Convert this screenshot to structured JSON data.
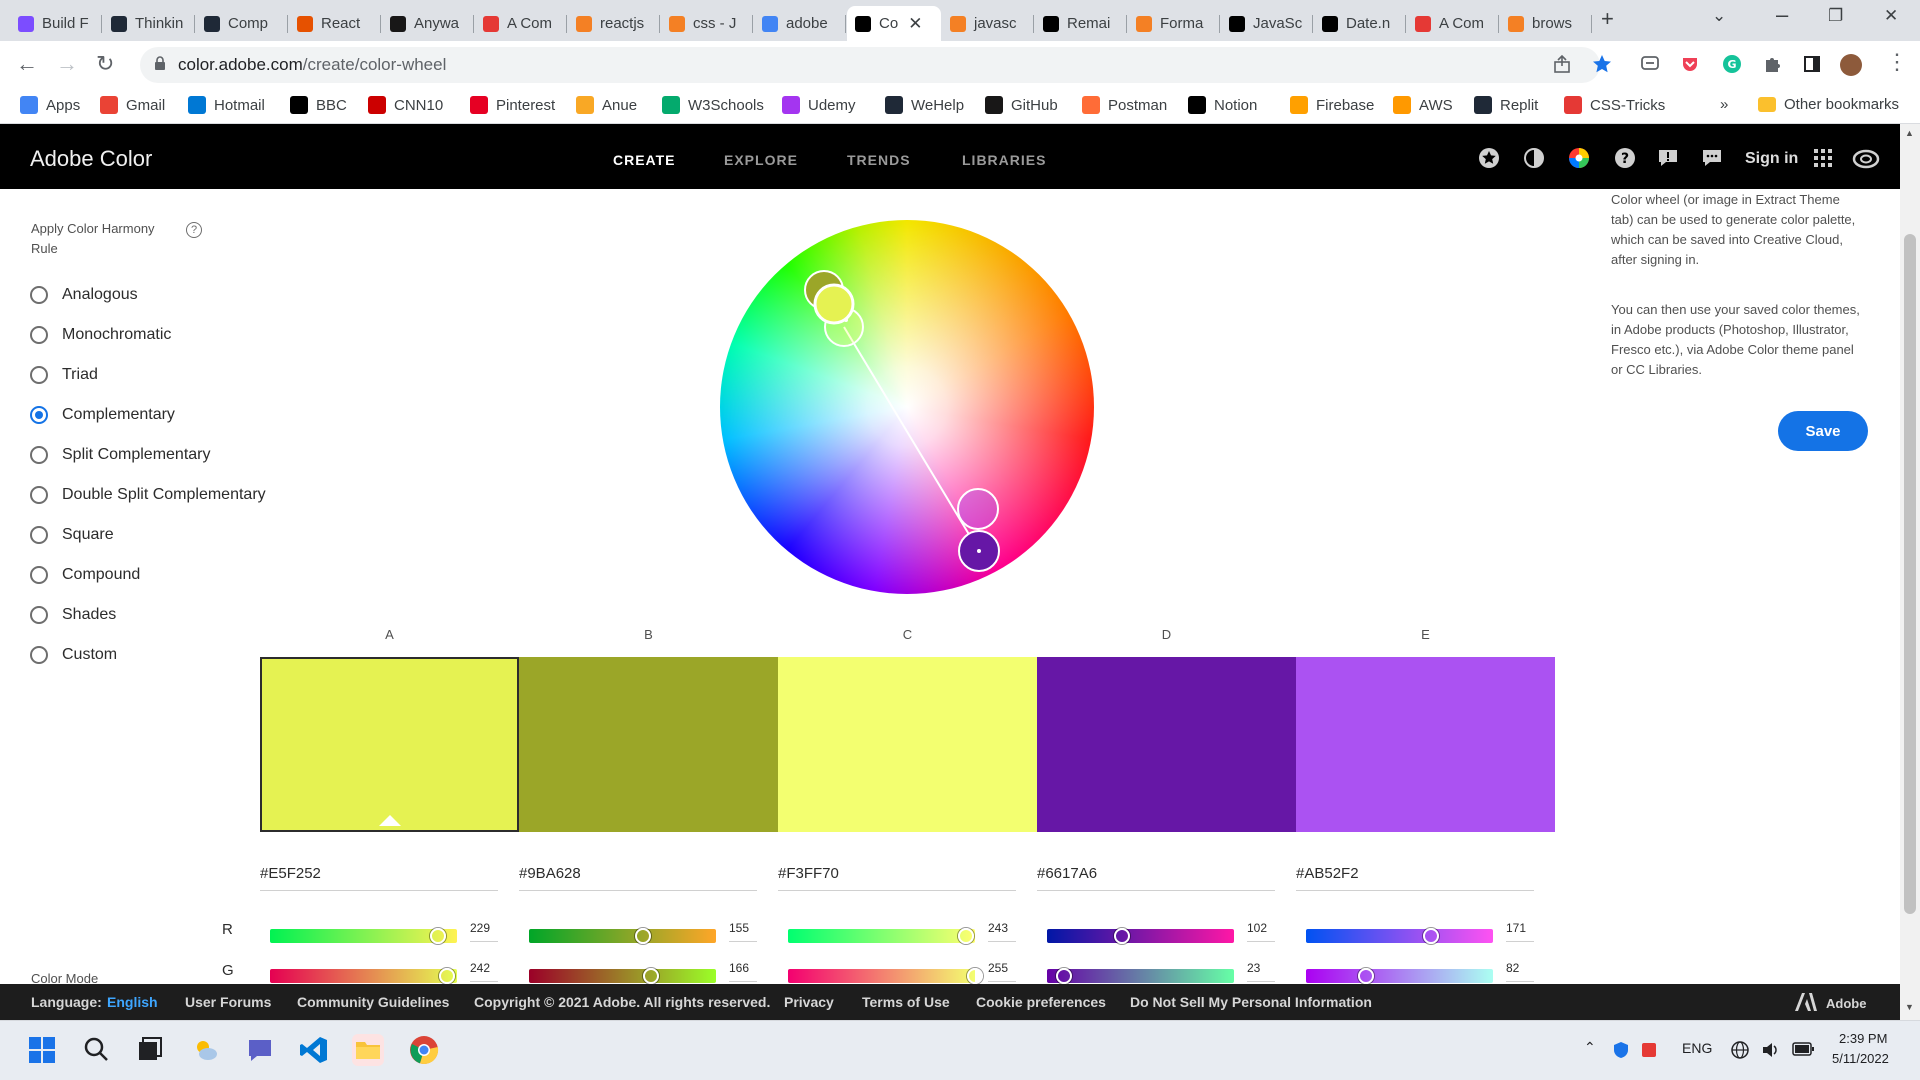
{
  "browser": {
    "tabs": [
      {
        "label": "Build F",
        "color": "#7c4dff"
      },
      {
        "label": "Thinkin",
        "color": "#1f2937"
      },
      {
        "label": "Comp",
        "color": "#1f2937"
      },
      {
        "label": "React",
        "color": "#e65100"
      },
      {
        "label": "Anywa",
        "color": "#181717"
      },
      {
        "label": "A Com",
        "color": "#e53935"
      },
      {
        "label": "reactjs",
        "color": "#f48024"
      },
      {
        "label": "css - J",
        "color": "#f48024"
      },
      {
        "label": "adobe",
        "color": "#4285f4"
      },
      {
        "label": "Co",
        "color": "#000000",
        "active": true
      },
      {
        "label": "javasc",
        "color": "#f48024"
      },
      {
        "label": "Remai",
        "color": "#000000"
      },
      {
        "label": "Forma",
        "color": "#f48024"
      },
      {
        "label": "JavaSc",
        "color": "#000000"
      },
      {
        "label": "Date.n",
        "color": "#000000"
      },
      {
        "label": "A Com",
        "color": "#e53935"
      },
      {
        "label": "brows",
        "color": "#f48024"
      }
    ],
    "url_host": "color.adobe.com",
    "url_path": "/create/color-wheel",
    "bookmarks": [
      {
        "label": "Apps",
        "icon": "apps-icon",
        "color": "#4285f4"
      },
      {
        "label": "Gmail",
        "icon": "gmail-icon",
        "color": "#ea4335"
      },
      {
        "label": "Hotmail",
        "icon": "outlook-icon",
        "color": "#0078d4"
      },
      {
        "label": "BBC",
        "icon": "bbc-icon",
        "color": "#000000"
      },
      {
        "label": "CNN10",
        "icon": "cnn-icon",
        "color": "#cc0000"
      },
      {
        "label": "Pinterest",
        "icon": "pinterest-icon",
        "color": "#e60023"
      },
      {
        "label": "Anue",
        "icon": "anue-icon",
        "color": "#f9a825"
      },
      {
        "label": "W3Schools",
        "icon": "w3schools-icon",
        "color": "#04aa6d"
      },
      {
        "label": "Udemy",
        "icon": "udemy-icon",
        "color": "#a435f0"
      },
      {
        "label": "WeHelp",
        "icon": "wehelp-icon",
        "color": "#1f2937"
      },
      {
        "label": "GitHub",
        "icon": "github-icon",
        "color": "#181717"
      },
      {
        "label": "Postman",
        "icon": "postman-icon",
        "color": "#ff6c37"
      },
      {
        "label": "Notion",
        "icon": "notion-icon",
        "color": "#000000"
      },
      {
        "label": "Firebase",
        "icon": "firebase-icon",
        "color": "#ffa000"
      },
      {
        "label": "AWS",
        "icon": "aws-icon",
        "color": "#ff9900"
      },
      {
        "label": "Replit",
        "icon": "replit-icon",
        "color": "#1f2937"
      },
      {
        "label": "CSS-Tricks",
        "icon": "css-tricks-icon",
        "color": "#e53935"
      }
    ],
    "more_bookmarks": "»",
    "other_bookmarks": "Other bookmarks"
  },
  "header": {
    "brand": "Adobe Color",
    "nav": [
      "CREATE",
      "EXPLORE",
      "TRENDS",
      "LIBRARIES"
    ],
    "sign_in": "Sign in"
  },
  "harmony": {
    "title": "Apply Color Harmony Rule",
    "help": "?",
    "rules": [
      "Analogous",
      "Monochromatic",
      "Triad",
      "Complementary",
      "Split Complementary",
      "Double Split Complementary",
      "Square",
      "Compound",
      "Shades",
      "Custom"
    ],
    "selected": "Complementary"
  },
  "color_mode_label": "Color Mode",
  "info": {
    "p1": "Color wheel (or image in Extract Theme tab) can be used to generate color palette, which can be saved into Creative Cloud, after signing in.",
    "p2": "You can then use your saved color themes, in Adobe products (Photoshop, Illustrator, Fresco etc.), via Adobe Color theme panel or CC Libraries.",
    "save": "Save"
  },
  "swatches": [
    {
      "label": "A",
      "hex": "#E5F252",
      "r": 229,
      "g": 242,
      "selected": true
    },
    {
      "label": "B",
      "hex": "#9BA628",
      "r": 155,
      "g": 166
    },
    {
      "label": "C",
      "hex": "#F3FF70",
      "r": 243,
      "g": 255
    },
    {
      "label": "D",
      "hex": "#6617A6",
      "r": 102,
      "g": 23
    },
    {
      "label": "E",
      "hex": "#AB52F2",
      "r": 171,
      "g": 82
    }
  ],
  "channels": [
    "R",
    "G"
  ],
  "footer": {
    "language_label": "Language:",
    "language": "English",
    "links": [
      "User Forums",
      "Community Guidelines",
      "Copyright © 2021 Adobe. All rights reserved.",
      "Privacy",
      "Terms of Use",
      "Cookie preferences",
      "Do Not Sell My Personal Information"
    ],
    "adobe": "Adobe"
  },
  "taskbar": {
    "lang": "ENG",
    "time": "2:39 PM",
    "date": "5/11/2022"
  }
}
